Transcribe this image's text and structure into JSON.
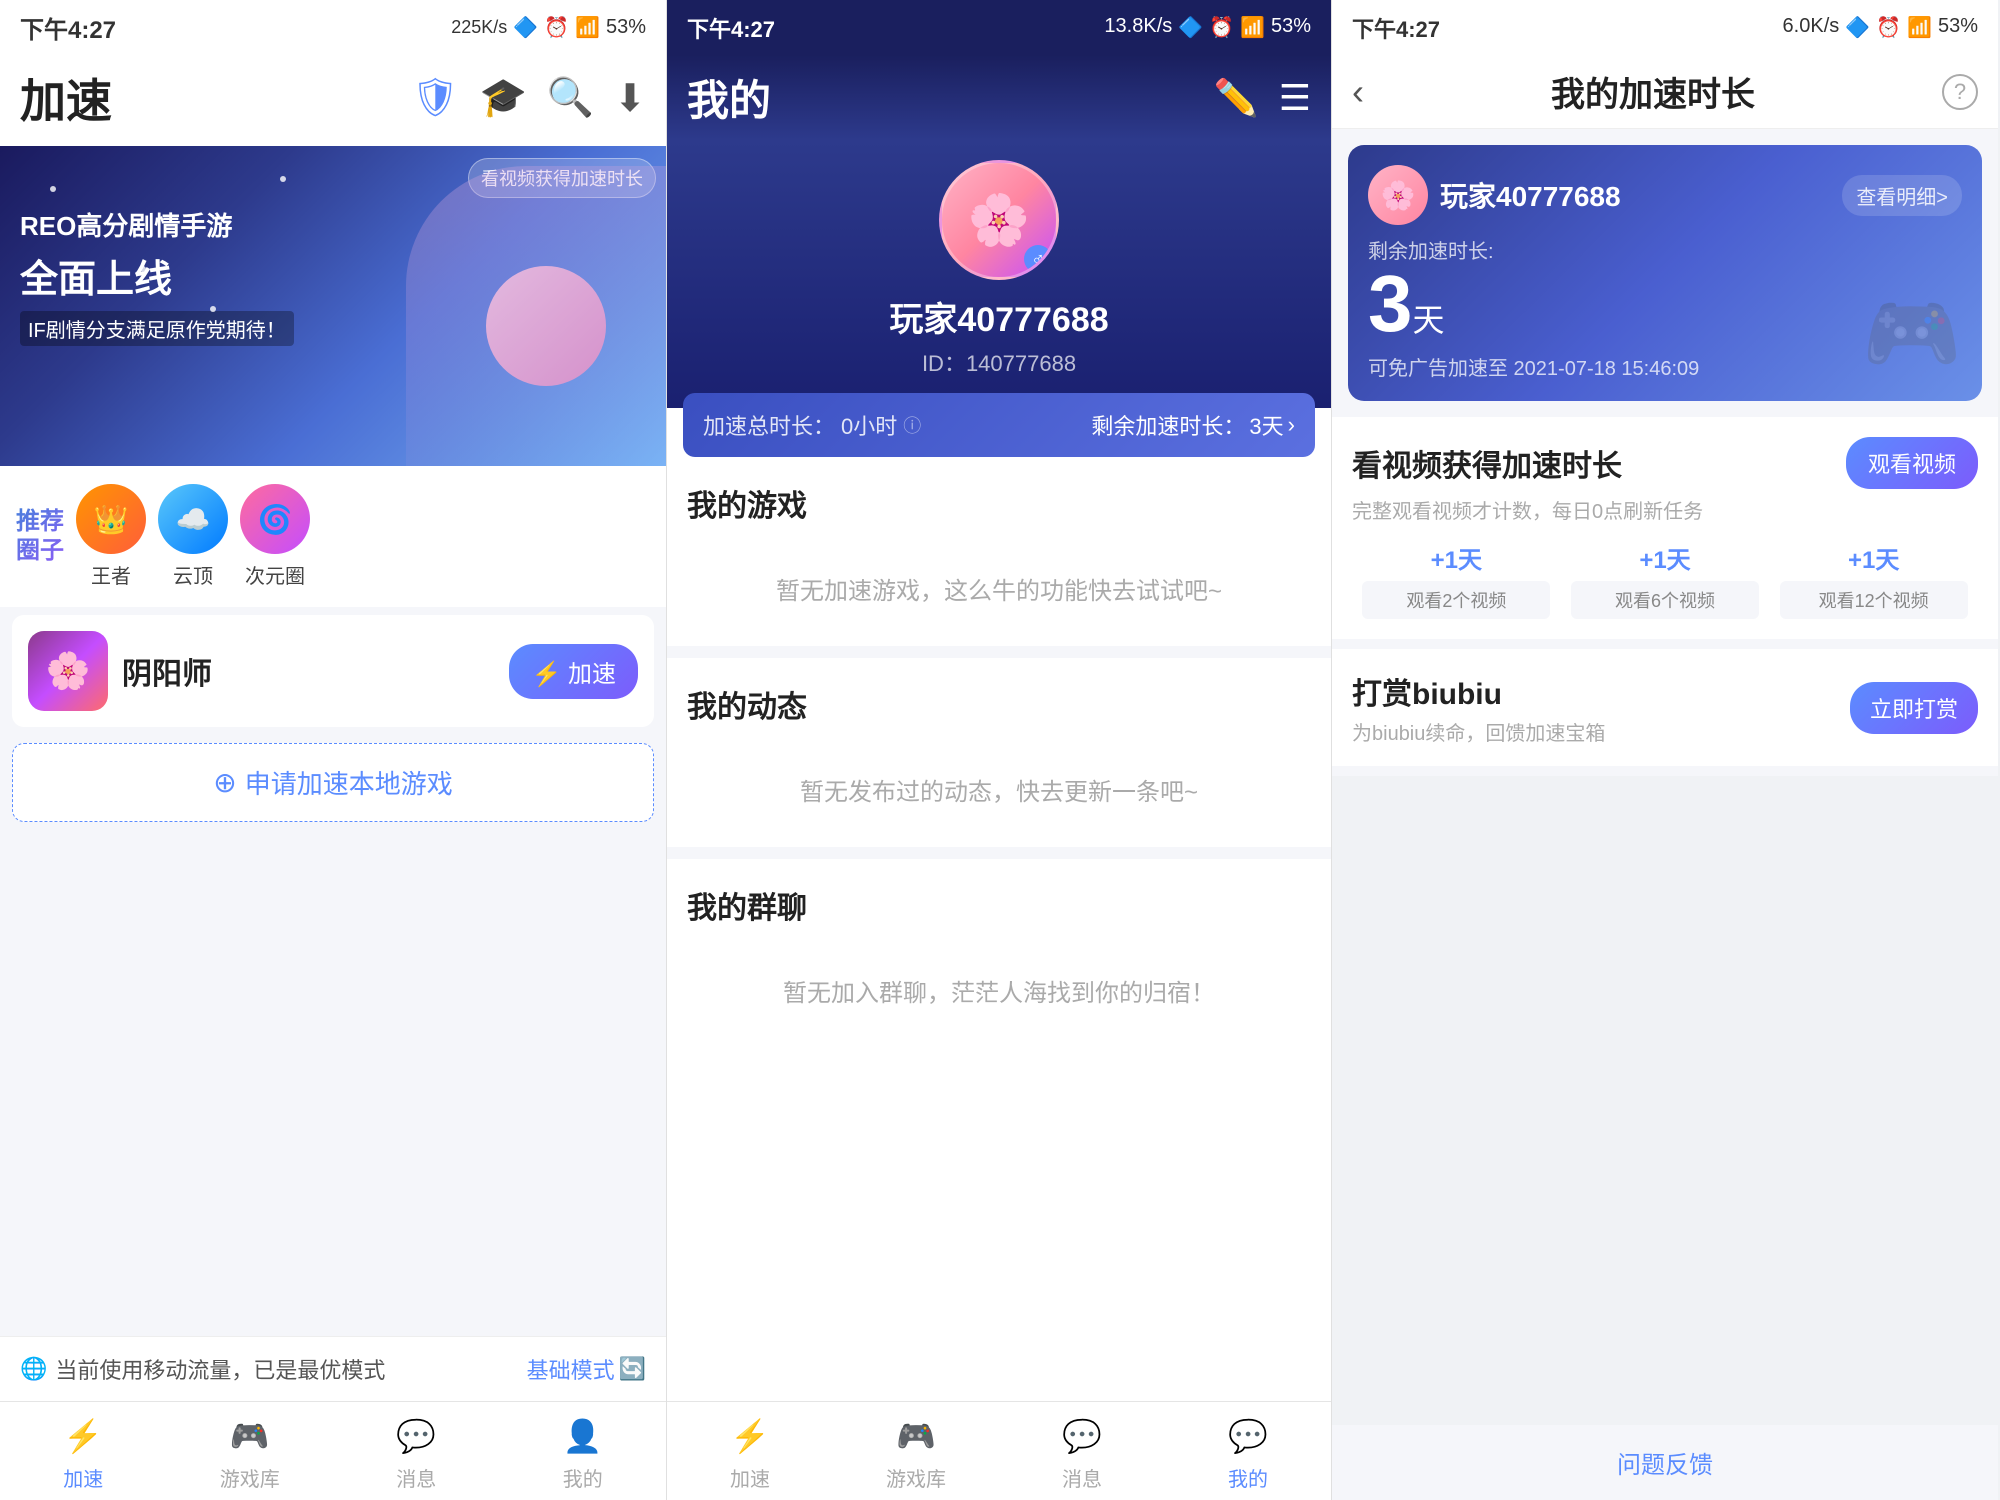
{
  "panel1": {
    "status_bar": {
      "time": "下午4:27",
      "speed": "225K/s",
      "battery": "53%"
    },
    "title": "加速",
    "header_icons": [
      "shield",
      "bell",
      "search",
      "download"
    ],
    "banner": {
      "video_btn": "看视频获得加速时长",
      "tag": "REO",
      "line1": "REO高分剧情手游",
      "line2": "全面上线",
      "line3": "IF剧情分支满足原作党期待！"
    },
    "circles": {
      "label": "推荐\n圈子",
      "items": [
        {
          "name": "王者",
          "avatar": "👑"
        },
        {
          "name": "云顶",
          "avatar": "☁️"
        },
        {
          "name": "次元圈",
          "avatar": "🌀"
        }
      ]
    },
    "game": {
      "name": "阴阳师",
      "boost_label": "⚡ 加速"
    },
    "apply_local": {
      "text": "申请加速本地游戏",
      "icon": "+"
    },
    "bottom_status": {
      "text": "当前使用移动流量，已是最优模式",
      "mode": "基础模式",
      "icon": "🌐"
    },
    "nav": [
      {
        "label": "加速",
        "active": true
      },
      {
        "label": "游戏库",
        "active": false
      },
      {
        "label": "消息",
        "active": false
      },
      {
        "label": "我的",
        "active": false
      }
    ]
  },
  "panel2": {
    "status_bar": {
      "time": "下午4:27",
      "speed": "13.8K/s",
      "battery": "53%"
    },
    "title": "我的",
    "profile": {
      "name": "玩家40777688",
      "id": "ID：140777688",
      "avatar_emoji": "🌸"
    },
    "accel_bar": {
      "total_label": "加速总时长：",
      "total_value": "0小时",
      "remaining_label": "剩余加速时长：",
      "remaining_value": "3天"
    },
    "sections": [
      {
        "title": "我的游戏",
        "empty_text": "暂无加速游戏，这么牛的功能快去试试吧~"
      },
      {
        "title": "我的动态",
        "empty_text": "暂无发布过的动态，快去更新一条吧~"
      },
      {
        "title": "我的群聊",
        "empty_text": "暂无加入群聊，茫茫人海找到你的归宿！"
      }
    ],
    "nav": [
      {
        "label": "加速",
        "active": false
      },
      {
        "label": "游戏库",
        "active": false
      },
      {
        "label": "消息",
        "active": false
      },
      {
        "label": "我的",
        "active": true
      }
    ]
  },
  "panel3": {
    "status_bar": {
      "time": "下午4:27",
      "speed": "6.0K/s",
      "battery": "53%"
    },
    "title": "我的加速时长",
    "back_label": "‹",
    "help_label": "?",
    "card": {
      "username": "玩家40777688",
      "detail_btn": "查看明细>",
      "remaining_label": "剩余加速时长:",
      "days": "3",
      "unit": "天",
      "expire_text": "可免广告加速至 2021-07-18 15:46:09"
    },
    "video_section": {
      "title": "看视频获得加速时长",
      "subtitle": "完整观看视频才计数，每日0点刷新任务",
      "watch_btn": "观看视频",
      "rewards": [
        {
          "plus": "+1天",
          "desc": "观看2个视频"
        },
        {
          "plus": "+1天",
          "desc": "观看6个视频"
        },
        {
          "plus": "+1天",
          "desc": "观看12个视频"
        }
      ]
    },
    "tip_section": {
      "title": "打赏biubiu",
      "subtitle": "为biubiu续命，回馈加速宝箱",
      "btn": "立即打赏"
    },
    "feedback": "问题反馈"
  }
}
